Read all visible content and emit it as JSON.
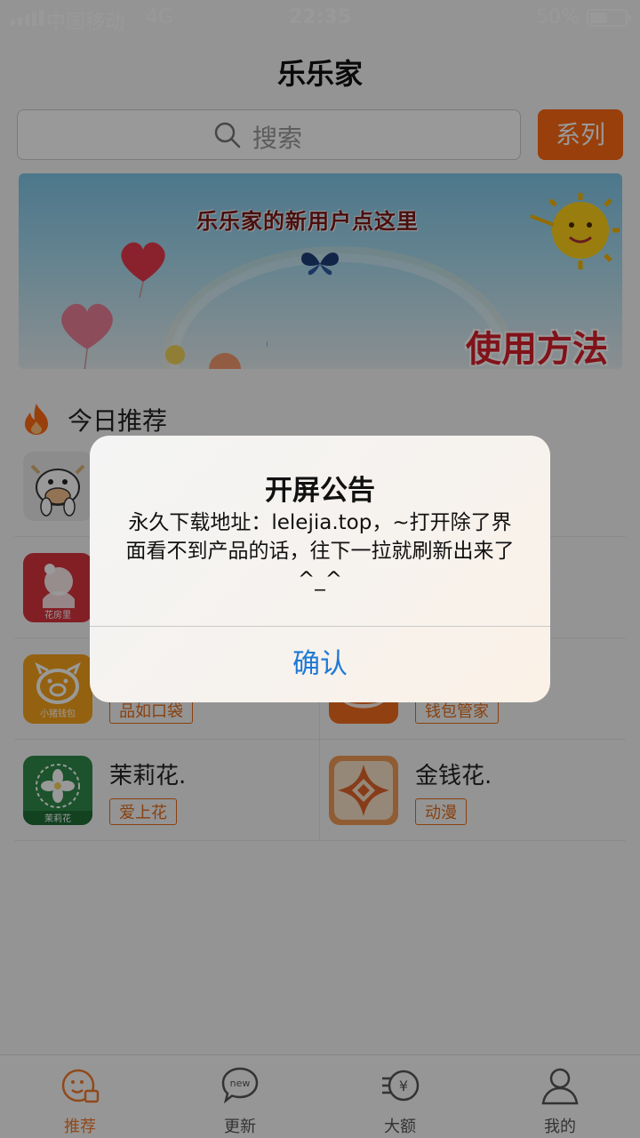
{
  "status_bar": {
    "carrier": "中国移动",
    "network": "4G",
    "time": "22:35",
    "battery_percent_text": "50%",
    "battery_level": 0.5
  },
  "header": {
    "title": "乐乐家",
    "search_placeholder": "搜索",
    "series_button": "系列"
  },
  "banner": {
    "headline": "乐乐家的新用户点这里",
    "cta": "使用方法"
  },
  "section": {
    "title": "今日推荐",
    "icon": "fire-icon"
  },
  "apps": [
    {
      "name": "",
      "tag": "",
      "icon": "cow-mascot-icon",
      "icon_caption": ""
    },
    {
      "name": "",
      "tag": "",
      "icon": "",
      "icon_caption": ""
    },
    {
      "name": "",
      "tag": "",
      "icon": "flower-girl-icon",
      "icon_caption": "花房里"
    },
    {
      "name": "",
      "tag": "",
      "icon": "",
      "icon_caption": ""
    },
    {
      "name": "",
      "tag": "品如口袋",
      "icon": "pig-icon",
      "icon_caption": "小猪钱包"
    },
    {
      "name": "",
      "tag": "钱包管家",
      "icon": "orange-round-icon",
      "icon_caption": ""
    },
    {
      "name": "茉莉花.",
      "tag": "爱上花",
      "icon": "jasmine-icon",
      "icon_caption": "茉莉花"
    },
    {
      "name": "金钱花.",
      "tag": "动漫",
      "icon": "coin-flower-icon",
      "icon_caption": ""
    }
  ],
  "tabbar": {
    "items": [
      {
        "label": "推荐",
        "icon": "recommend-icon",
        "active": true
      },
      {
        "label": "更新",
        "icon": "new-bubble-icon",
        "badge": "new",
        "active": false
      },
      {
        "label": "大额",
        "icon": "yuan-coin-icon",
        "active": false
      },
      {
        "label": "我的",
        "icon": "user-icon",
        "active": false
      }
    ]
  },
  "dialog": {
    "title": "开屏公告",
    "message": "永久下载地址：lelejia.top，~打开除了界面看不到产品的话，往下一拉就刷新出来了^_^",
    "confirm": "确认"
  },
  "colors": {
    "accent": "#ff6a13",
    "tag": "#e36d1a",
    "link_blue": "#1f7ad6",
    "overlay": "rgba(0,0,0,0.40)"
  }
}
